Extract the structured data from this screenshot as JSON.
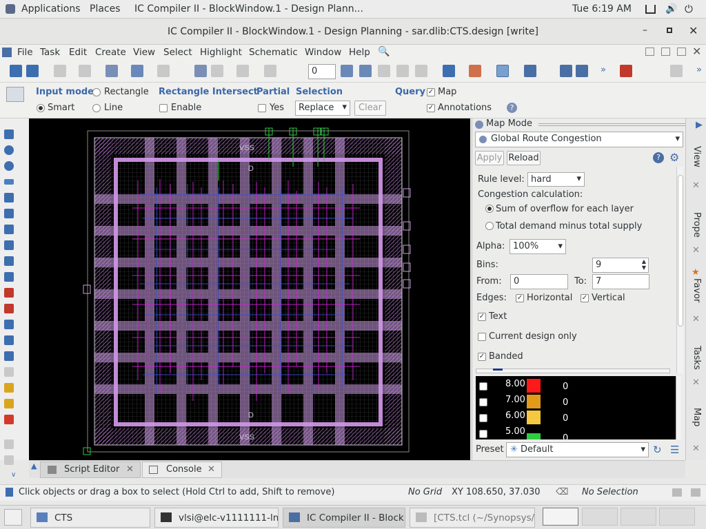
{
  "topbar": {
    "applications": "Applications",
    "places": "Places",
    "window_title": "IC Compiler II - BlockWindow.1 - Design Plann...",
    "clock": "Tue  6:19 AM"
  },
  "titlebar": {
    "title": "IC Compiler II - BlockWindow.1 - Design Planning - sar.dlib:CTS.design [write]"
  },
  "menubar": {
    "items": [
      "File",
      "Task",
      "Edit",
      "Create",
      "View",
      "Select",
      "Highlight",
      "Schematic",
      "Window",
      "Help"
    ]
  },
  "toolbar": {
    "spin_value": "0"
  },
  "options": {
    "input_mode": "Input mode",
    "rectangle": "Rectangle",
    "smart": "Smart",
    "line": "Line",
    "rect_intersect": "Rectangle Intersect",
    "enable": "Enable",
    "partial": "Partial",
    "yes": "Yes",
    "selection": "Selection",
    "replace": "Replace",
    "clear": "Clear",
    "query": "Query",
    "map": "Map",
    "annotations": "Annotations"
  },
  "canvas": {
    "labels": [
      "VSS",
      "D",
      "D",
      "VSS"
    ]
  },
  "panel": {
    "title": "Map Mode",
    "map_type": "Global Route Congestion",
    "apply": "Apply",
    "reload": "Reload",
    "rule_level_label": "Rule level:",
    "rule_level": "hard",
    "congestion_label": "Congestion calculation:",
    "opt1": "Sum of overflow for each layer",
    "opt2": "Total demand minus total supply",
    "alpha_label": "Alpha:",
    "alpha": "100%",
    "bins_label": "Bins:",
    "bins": "9",
    "from_label": "From:",
    "from": "0",
    "to_label": "To:",
    "to": "7",
    "edges_label": "Edges:",
    "horizontal": "Horizontal",
    "vertical": "Vertical",
    "text": "Text",
    "current_design": "Current design only",
    "banded": "Banded",
    "preset_label": "Preset",
    "preset": "Default"
  },
  "legend": [
    {
      "value": "8.00",
      "count": "0",
      "color": "#ff1a1a"
    },
    {
      "value": "7.00",
      "count": "0",
      "color": "#e29a1a"
    },
    {
      "value": "6.00",
      "count": "0",
      "color": "#f5c842"
    },
    {
      "value": "5.00",
      "count": "0",
      "color": "#2ecc40"
    }
  ],
  "vtabs": {
    "view": "View",
    "prop": "Prope",
    "fav": "Favor",
    "tasks": "Tasks",
    "map": "Map"
  },
  "bottomtabs": {
    "script_editor": "Script Editor",
    "console": "Console"
  },
  "status": {
    "hint": "Click objects or drag a box to select (Hold Ctrl to add, Shift to remove)",
    "grid": "No Grid",
    "xy": "XY 108.650, 37.030",
    "selection": "No Selection"
  },
  "taskbar": {
    "t1": "CTS",
    "t2": "vlsi@elc-v1111111-ln...",
    "t3": "IC Compiler II - Block...",
    "t4": "[CTS.tcl (~/Synopsys/..."
  }
}
